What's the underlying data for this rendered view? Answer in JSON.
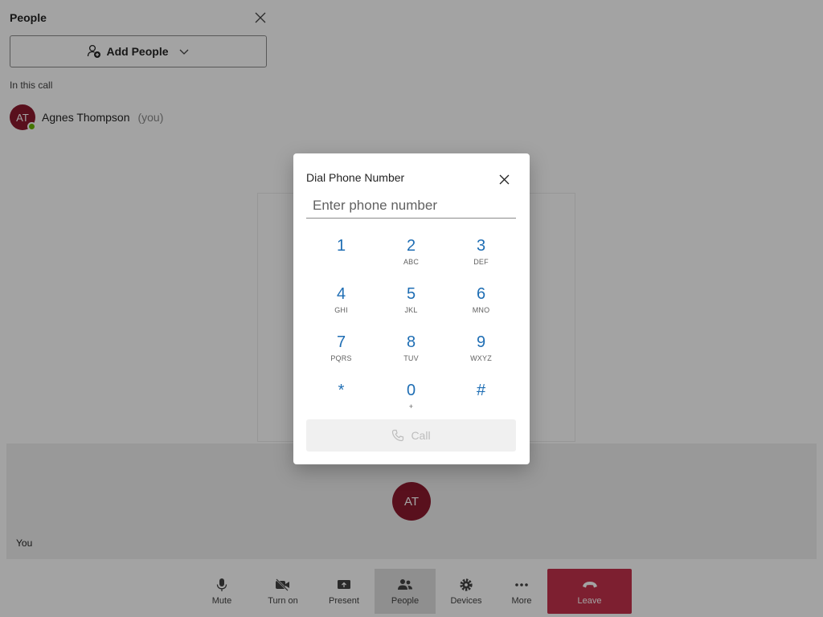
{
  "people_panel": {
    "title": "People",
    "add_people_label": "Add People",
    "section_label": "In this call",
    "participant": {
      "initials": "AT",
      "name": "Agnes Thompson",
      "you_suffix": "(you)",
      "presence_color": "#6bb700"
    }
  },
  "self_tile": {
    "initials": "AT",
    "label": "You"
  },
  "toolbar": {
    "buttons": [
      {
        "label": "Mute",
        "icon": "mic-icon"
      },
      {
        "label": "Turn on",
        "icon": "camera-off-icon"
      },
      {
        "label": "Present",
        "icon": "share-screen-icon"
      },
      {
        "label": "People",
        "icon": "people-icon",
        "active": true
      },
      {
        "label": "Devices",
        "icon": "gear-icon"
      },
      {
        "label": "More",
        "icon": "more-icon"
      },
      {
        "label": "Leave",
        "icon": "hang-up-icon"
      }
    ]
  },
  "dialog": {
    "title": "Dial Phone Number",
    "placeholder": "Enter phone number",
    "keys": [
      {
        "digit": "1",
        "letters": ""
      },
      {
        "digit": "2",
        "letters": "ABC"
      },
      {
        "digit": "3",
        "letters": "DEF"
      },
      {
        "digit": "4",
        "letters": "GHI"
      },
      {
        "digit": "5",
        "letters": "JKL"
      },
      {
        "digit": "6",
        "letters": "MNO"
      },
      {
        "digit": "7",
        "letters": "PQRS"
      },
      {
        "digit": "8",
        "letters": "TUV"
      },
      {
        "digit": "9",
        "letters": "WXYZ"
      },
      {
        "digit": "*",
        "letters": ""
      },
      {
        "digit": "0",
        "letters": "+"
      },
      {
        "digit": "#",
        "letters": ""
      }
    ],
    "call_label": "Call"
  },
  "colors": {
    "accent": "#1f6eb4",
    "avatar": "#8b1a2e",
    "leave": "#c4314b"
  }
}
